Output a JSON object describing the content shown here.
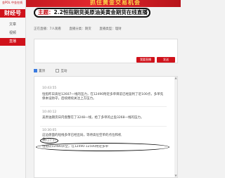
{
  "banner": {
    "promo": "抓住黄金交易机会"
  },
  "sidebar": {
    "logo_small": "金POL 中金在线",
    "logo_main": "财经号",
    "items": [
      {
        "label": "文章",
        "active": false
      },
      {
        "label": "视频",
        "active": false
      },
      {
        "label": "直播",
        "active": true
      }
    ]
  },
  "headline": {
    "prefix": "主题：",
    "text": "2.2恒指期货美原油美黄金期货在线直播"
  },
  "info": {
    "status": "正在直播：7人观看",
    "category": "直播分类：期货",
    "type": "直播类型：理财"
  },
  "composer": {
    "placeholder": "",
    "send_label": "发送",
    "publish_label": "我要直播"
  },
  "options": {
    "opt1": "置顶",
    "opt2": "互动"
  },
  "messages": [
    {
      "time": "10:43:55",
      "text": "恒指昨日高位12607一线的压力，在12490附近多单目前已经盈利了近100点，多单先保本设防守，后续继续关注上方压力。"
    },
    {
      "time": "10:40:12",
      "text": "美原油期货日内盘整在了3248一线，给了多单的止盈3268一线的压力。"
    },
    {
      "time": "10:30:05",
      "text": "这边盘面的短线多单已经出局，等待高位空单的点位和机会。"
    },
    {
      "time": "10:27:37",
      "text": "恒指以12480开空，在12490-12500附近多单"
    }
  ]
}
